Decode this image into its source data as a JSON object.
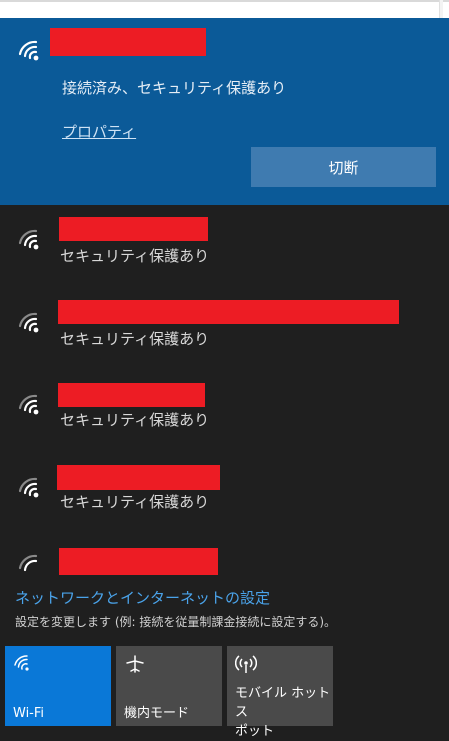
{
  "connected_network": {
    "status": "接続済み、セキュリティ保護あり",
    "properties_link": "プロパティ",
    "disconnect_button": "切断",
    "name_redacted": true
  },
  "networks": [
    {
      "status": "セキュリティ保護あり",
      "name_redacted": true
    },
    {
      "status": "セキュリティ保護あり",
      "name_redacted": true
    },
    {
      "status": "セキュリティ保護あり",
      "name_redacted": true
    },
    {
      "status": "セキュリティ保護あり",
      "name_redacted": true
    },
    {
      "status": "",
      "name_redacted": true
    }
  ],
  "settings": {
    "link": "ネットワークとインターネットの設定",
    "description": "設定を変更します (例: 接続を従量制課金接続に設定する)。"
  },
  "quick_actions": [
    {
      "label": "Wi-Fi",
      "icon": "wifi-icon",
      "active": true
    },
    {
      "label": "機内モード",
      "icon": "airplane-icon",
      "active": false
    },
    {
      "label": "モバイル ホットス\nポット",
      "icon": "hotspot-icon",
      "active": false
    }
  ],
  "colors": {
    "connected_bg": "#0b5a98",
    "panel_bg": "#1f1f1f",
    "accent": "#0a78d7",
    "link": "#4aa3ea",
    "redaction": "#ed1c24"
  }
}
